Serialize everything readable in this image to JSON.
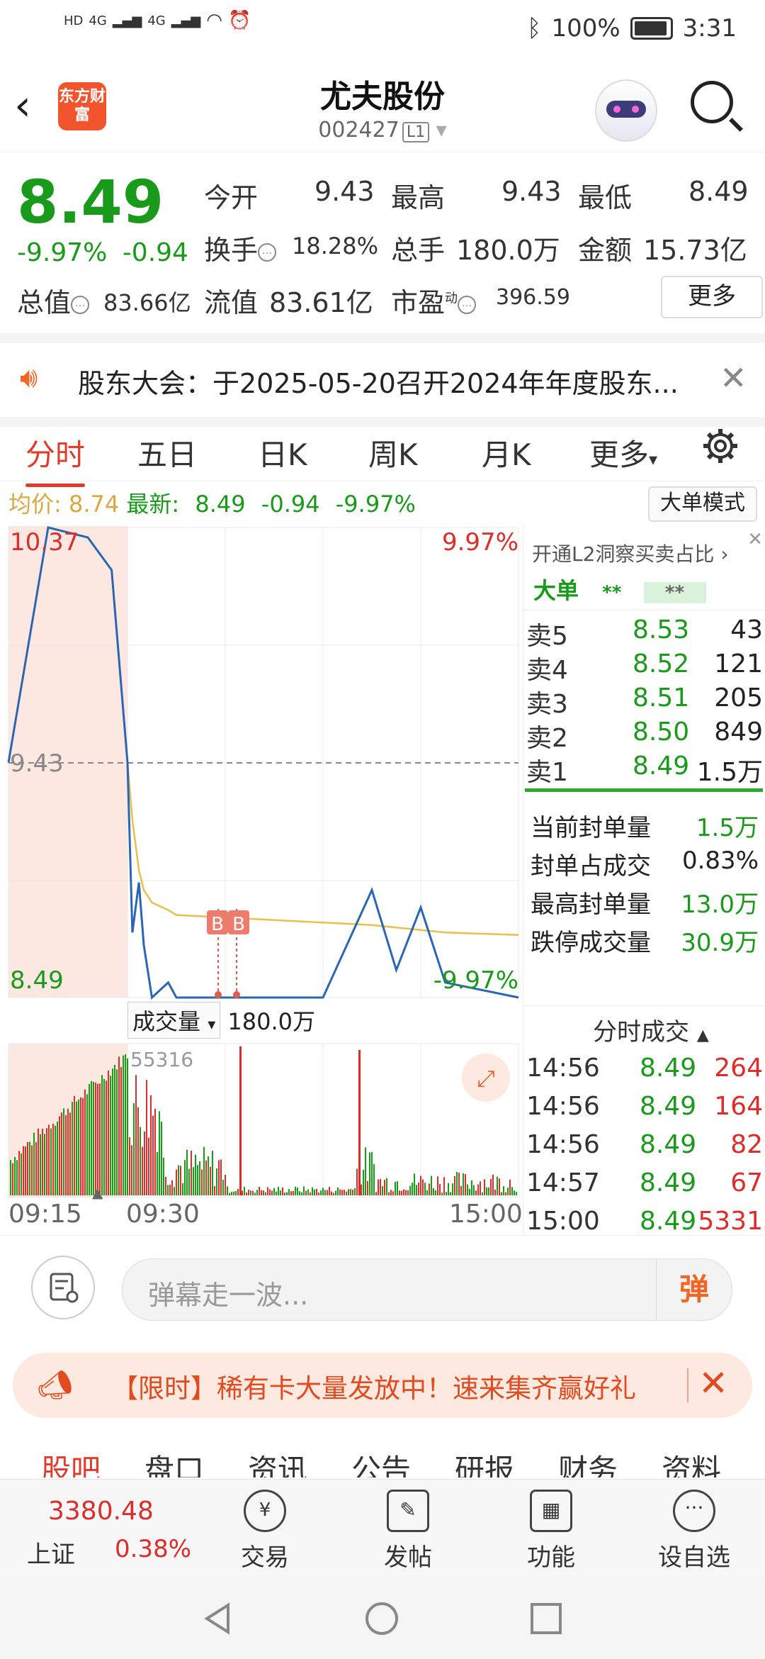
{
  "status_bar": {
    "network": [
      "HD",
      "4G",
      "4G"
    ],
    "bluetooth_icon": "bluetooth-icon",
    "battery": "100%",
    "time": "3:31"
  },
  "header": {
    "logo_text": "东方财富",
    "stock_name": "尤夫股份",
    "stock_code": "002427",
    "level_badge": "L1"
  },
  "quote": {
    "price": "8.49",
    "pct": "-9.97%",
    "chg": "-0.94",
    "fields": [
      {
        "label": "今开",
        "value": "9.43"
      },
      {
        "label": "最高",
        "value": "9.43"
      },
      {
        "label": "最低",
        "value": "8.49"
      },
      {
        "label": "换手",
        "value": "18.28%"
      },
      {
        "label": "总手",
        "value": "180.0万"
      },
      {
        "label": "金额",
        "value": "15.73亿"
      },
      {
        "label": "总值",
        "value": "83.66亿"
      },
      {
        "label": "流值",
        "value": "83.61亿"
      },
      {
        "label": "市盈",
        "value": "396.59",
        "sup": "动"
      }
    ],
    "more_label": "更多"
  },
  "notice": {
    "text": "股东大会：于2025-05-20召开2024年年度股东..."
  },
  "tabs": {
    "items": [
      "分时",
      "五日",
      "日K",
      "周K",
      "月K",
      "更多"
    ],
    "active": 0
  },
  "info": {
    "avg_label": "均价:",
    "avg_value": "8.74",
    "latest_label": "最新:",
    "latest_value": "8.49",
    "latest_chg": "-0.94",
    "latest_pct": "-9.97%",
    "mode_btn": "大单模式"
  },
  "chart": {
    "top_price": "10.37",
    "top_pct": "9.97%",
    "mid_price": "9.43",
    "bot_price": "8.49",
    "bot_pct": "-9.97%",
    "markers": [
      "B",
      "B"
    ],
    "vol_selector": "成交量",
    "vol_total": "180.0万",
    "vol_max": "55316",
    "time_start": "09:15",
    "time_open": "09:30",
    "time_end": "15:00",
    "colors": {
      "price_line": "#2a66b3",
      "avg_line": "#e8c04a",
      "up": "#e02b2b",
      "down": "#13a113",
      "auction_bg": "#fce8e0"
    }
  },
  "chart_data": {
    "type": "line",
    "series": [
      {
        "name": "均价",
        "values": [
          null,
          null,
          null,
          null,
          9.43,
          9.2,
          9.0,
          8.92,
          8.87,
          8.84,
          8.82,
          8.81,
          8.8,
          8.79,
          8.78,
          8.77,
          8.76,
          8.75,
          8.74
        ]
      },
      {
        "name": "最新",
        "values": [
          9.43,
          10.37,
          10.33,
          10.2,
          9.43,
          8.75,
          8.95,
          8.7,
          8.49,
          8.55,
          8.49,
          8.49,
          8.49,
          8.49,
          8.92,
          8.6,
          8.85,
          8.55,
          8.49
        ]
      }
    ],
    "x": [
      "09:15",
      "09:20",
      "09:25",
      "09:28",
      "09:30",
      "09:33",
      "09:37",
      "09:40",
      "09:45",
      "09:55",
      "10:00",
      "10:30",
      "11:00",
      "13:00",
      "13:30",
      "13:45",
      "14:00",
      "14:15",
      "15:00"
    ],
    "ylim": [
      8.49,
      10.37
    ],
    "reference": 9.43
  },
  "right_panel": {
    "l2_banner": "开通L2洞察买卖占比",
    "big_label": "大单",
    "big_values": [
      "**",
      "**"
    ],
    "orderbook": [
      {
        "name": "卖5",
        "price": "8.53",
        "qty": "43"
      },
      {
        "name": "卖4",
        "price": "8.52",
        "qty": "121"
      },
      {
        "name": "卖3",
        "price": "8.51",
        "qty": "205"
      },
      {
        "name": "卖2",
        "price": "8.50",
        "qty": "849"
      },
      {
        "name": "卖1",
        "price": "8.49",
        "qty": "1.5万"
      }
    ],
    "seal": [
      {
        "label": "当前封单量",
        "value": "1.5万",
        "color": "green"
      },
      {
        "label": "封单占成交",
        "value": "0.83%",
        "color": "dark"
      },
      {
        "label": "最高封单量",
        "value": "13.0万",
        "color": "green"
      },
      {
        "label": "跌停成交量",
        "value": "30.9万",
        "color": "green"
      }
    ],
    "ticks_title": "分时成交",
    "ticks": [
      {
        "time": "14:56",
        "price": "8.49",
        "qty": "264"
      },
      {
        "time": "14:56",
        "price": "8.49",
        "qty": "164"
      },
      {
        "time": "14:56",
        "price": "8.49",
        "qty": "82"
      },
      {
        "time": "14:57",
        "price": "8.49",
        "qty": "67"
      },
      {
        "time": "15:00",
        "price": "8.49",
        "qty": "5331"
      }
    ]
  },
  "comment": {
    "placeholder": "弹幕走一波...",
    "dan_label": "弹"
  },
  "promo": {
    "text": "【限时】稀有卡大量发放中！速来集齐赢好礼"
  },
  "subtabs": [
    "股吧",
    "盘口",
    "资讯",
    "公告",
    "研报",
    "财务",
    "资料"
  ],
  "bottom_nav": {
    "index_value": "3380.48",
    "index_name": "上证",
    "index_pct": "0.38%",
    "items": [
      "交易",
      "发帖",
      "功能",
      "设自选"
    ]
  }
}
